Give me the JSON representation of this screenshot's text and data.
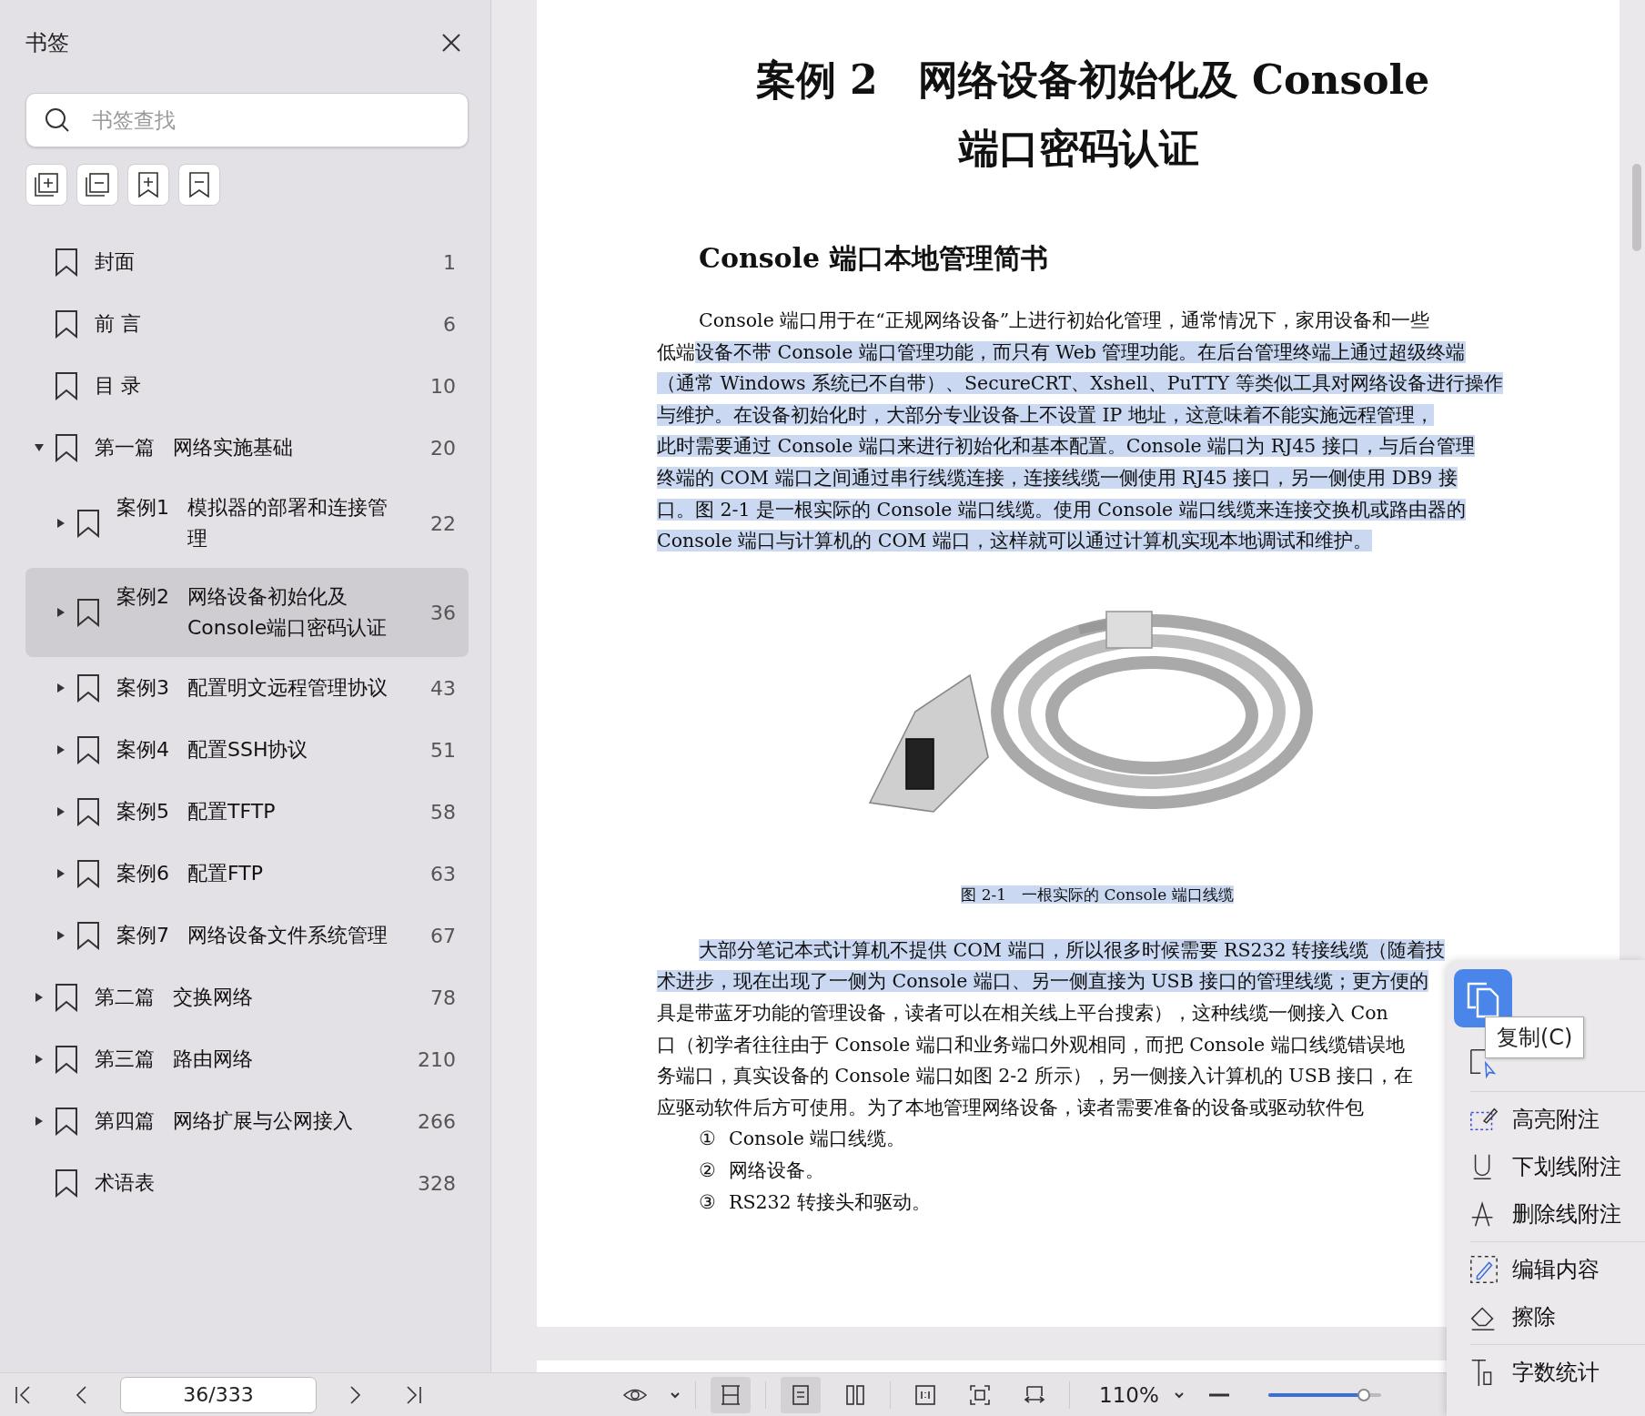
{
  "sidebar": {
    "title": "书签",
    "search": {
      "placeholder": "书签查找"
    },
    "bookmarks": [
      {
        "title": "封面",
        "page": "1",
        "selected": false
      },
      {
        "title": "前 言",
        "page": "6",
        "selected": false
      },
      {
        "title": "目 录",
        "page": "10",
        "selected": false
      },
      {
        "number": "第一篇",
        "title": "网络实施基础",
        "page": "20",
        "expanded": true,
        "selected": false,
        "children": [
          {
            "number": "案例1",
            "title": "模拟器的部署和连接管理",
            "page": "22",
            "expanded": false,
            "selected": false
          },
          {
            "number": "案例2",
            "title": "网络设备初始化及Console端口密码认证",
            "page": "36",
            "expanded": false,
            "selected": true
          },
          {
            "number": "案例3",
            "title": "配置明文远程管理协议",
            "page": "43",
            "expanded": false,
            "selected": false
          },
          {
            "number": "案例4",
            "title": "配置SSH协议",
            "page": "51",
            "expanded": false,
            "selected": false
          },
          {
            "number": "案例5",
            "title": "配置TFTP",
            "page": "58",
            "expanded": false,
            "selected": false
          },
          {
            "number": "案例6",
            "title": "配置FTP",
            "page": "63",
            "expanded": false,
            "selected": false
          },
          {
            "number": "案例7",
            "title": "网络设备文件系统管理",
            "page": "67",
            "expanded": false,
            "selected": false
          }
        ]
      },
      {
        "number": "第二篇",
        "title": "交换网络",
        "page": "78",
        "expanded": false,
        "selected": false
      },
      {
        "number": "第三篇",
        "title": "路由网络",
        "page": "210",
        "expanded": false,
        "selected": false
      },
      {
        "number": "第四篇",
        "title": "网络扩展与公网接入",
        "page": "266",
        "expanded": false,
        "selected": false
      },
      {
        "title": "术语表",
        "page": "328",
        "selected": false
      }
    ]
  },
  "document": {
    "title_lines": [
      "案例 2　网络设备初始化及 Console",
      "端口密码认证"
    ],
    "heading": "Console 端口本地管理简书",
    "paragraphs": [
      {
        "lines": [
          [
            {
              "text": "Console 端口用于在“正规网络设备”上进行初始化管理，通常情况下，家用设备和一些",
              "highlighted": false
            }
          ],
          [
            {
              "text": "低端",
              "highlighted": false
            },
            {
              "text": "设备不带 Console 端口管理功能，而只有 Web 管理功能。在后台管理终端上通过超级终端",
              "highlighted": true
            }
          ],
          [
            {
              "text": "（通常 Windows 系统已不自带）、SecureCRT、Xshell、PuTTY 等类似工具对网络设备进行操作",
              "highlighted": true
            }
          ],
          [
            {
              "text": "与维护。在设备初始化时，大部分专业设备上不设置 IP 地址，这意味着不能实施远程管理，",
              "highlighted": true
            }
          ],
          [
            {
              "text": "此时需要通过 Console 端口来进行初始化和基本配置。Console 端口为 RJ45 接口，与后台管理",
              "highlighted": true
            }
          ],
          [
            {
              "text": "终端的 COM 端口之间通过串行线缆连接，连接线缆一侧使用 RJ45 接口，另一侧使用 DB9 接",
              "highlighted": true
            }
          ],
          [
            {
              "text": "口。图 2-1 是一根实际的 Console 端口线缆。使用 Console 端口线缆来连接交换机或路由器的",
              "highlighted": true
            }
          ],
          [
            {
              "text": "Console 端口与计算机的 COM 端口，这样就可以通过计算机实现本地调试和维护。",
              "highlighted": true
            }
          ]
        ]
      },
      {
        "figure": {
          "caption": "图 2-1　一根实际的 Console 端口线缆",
          "highlighted": true
        }
      },
      {
        "lines": [
          [
            {
              "text": "大部分笔记本式计算机不提供 COM 端口，所以很多时候需要 RS232 转接线缆（随着技",
              "highlighted": true
            }
          ],
          [
            {
              "text": "术进步，现在出现了一侧为 Console 端口、另一侧直接为 USB 接口的管理线缆；更方便的",
              "highlighted": true
            }
          ],
          [
            {
              "text": "具是带蓝牙功能的管理设备，读者可以在相关线上平台搜索），这种线缆一侧接入 Con",
              "highlighted": false
            }
          ],
          [
            {
              "text": "口（初学者往往由于 Console 端口和业务端口外观相同，而把 Console 端口线缆错误地",
              "highlighted": false
            }
          ],
          [
            {
              "text": "务端口，真实设备的 Console 端口如图 2-2 所示），另一侧接入计算机的 USB 接口，在",
              "highlighted": false
            }
          ],
          [
            {
              "text": "应驱动软件后方可使用。为了本地管理网络设备，读者需要准备的设备或驱动软件包",
              "highlighted": false
            }
          ]
        ]
      }
    ],
    "list": [
      {
        "marker": "①",
        "text": "Console 端口线缆。"
      },
      {
        "marker": "②",
        "text": "网络设备。"
      },
      {
        "marker": "③",
        "text": "RS232 转接头和驱动。"
      }
    ]
  },
  "context_menu": {
    "tooltip": "复制(C)",
    "groups": [
      [
        {
          "kind": "select"
        }
      ],
      [
        {
          "kind": "highlight",
          "label": "高亮附注"
        },
        {
          "kind": "underline",
          "label": "下划线附注"
        },
        {
          "kind": "strike",
          "label": "删除线附注"
        }
      ],
      [
        {
          "kind": "edit",
          "label": "编辑内容"
        },
        {
          "kind": "erase",
          "label": "擦除"
        }
      ],
      [
        {
          "kind": "count",
          "label": "字数统计"
        }
      ]
    ]
  },
  "toolbar": {
    "page": "36/333",
    "zoom": "110%",
    "zoom_slider": {
      "level": 0.85
    },
    "view_tools": [
      {
        "kind": "fit-width",
        "selected": true
      },
      {
        "kind": "single",
        "selected": true
      },
      {
        "kind": "double",
        "selected": false
      },
      {
        "kind": "actual",
        "selected": false
      },
      {
        "kind": "fit-page",
        "selected": false
      },
      {
        "kind": "rotate",
        "selected": false
      }
    ]
  }
}
